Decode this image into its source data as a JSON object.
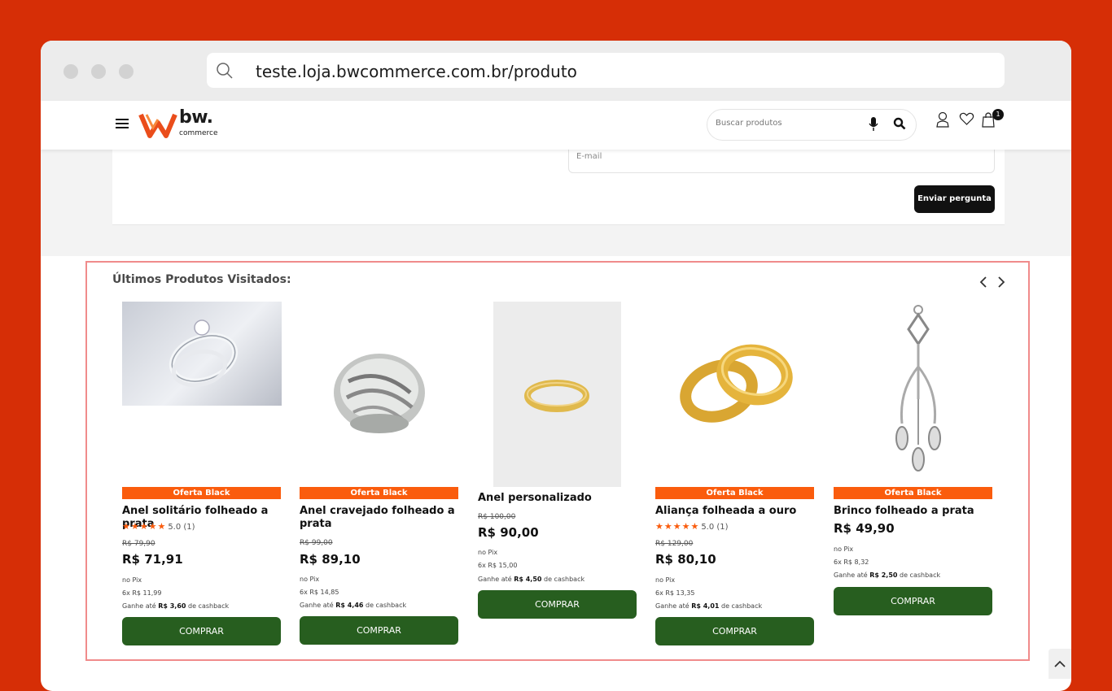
{
  "browser": {
    "url": "teste.loja.bwcommerce.com.br/produto"
  },
  "header": {
    "logo_text": "bw.",
    "logo_sub": "commerce",
    "search_placeholder": "Buscar produtos",
    "cart_count": "1"
  },
  "form": {
    "email_placeholder": "E-mail",
    "send_label": "Enviar pergunta"
  },
  "recent": {
    "title": "Últimos Produtos Visitados:",
    "products": [
      {
        "tag": "Oferta Black",
        "name": "Anel solitário folheado a prata",
        "stars": "★★★★★",
        "rating": "5.0 (1)",
        "old_price": "R$ 79,90",
        "price": "R$ 71,91",
        "pix": "no  Pix",
        "installments": "6x  R$ 11,99",
        "cashback_pre": "Ganhe até ",
        "cashback_value": "R$ 3,60",
        "cashback_post": " de cashback",
        "buy": "COMPRAR"
      },
      {
        "tag": "Oferta Black",
        "name": "Anel cravejado folheado a prata",
        "old_price": "R$ 99,00",
        "price": "R$ 89,10",
        "pix": "no  Pix",
        "installments": "6x  R$ 14,85",
        "cashback_pre": "Ganhe até ",
        "cashback_value": "R$ 4,46",
        "cashback_post": " de cashback",
        "buy": "COMPRAR"
      },
      {
        "name": "Anel personalizado",
        "old_price": "R$ 100,00",
        "price": "R$ 90,00",
        "pix": "no  Pix",
        "installments": "6x  R$ 15,00",
        "cashback_pre": "Ganhe até ",
        "cashback_value": "R$ 4,50",
        "cashback_post": " de cashback",
        "buy": "COMPRAR"
      },
      {
        "tag": "Oferta Black",
        "name": "Aliança folheada a ouro",
        "stars": "★★★★★",
        "rating": "5.0 (1)",
        "old_price": "R$ 129,00",
        "price": "R$ 80,10",
        "pix": "no  Pix",
        "installments": "6x  R$ 13,35",
        "cashback_pre": "Ganhe até ",
        "cashback_value": "R$ 4,01",
        "cashback_post": " de cashback",
        "buy": "COMPRAR"
      },
      {
        "tag": "Oferta Black",
        "name": "Brinco folheado a prata",
        "price": "R$ 49,90",
        "pix": "no  Pix",
        "installments": "6x  R$ 8,32",
        "cashback_pre": "Ganhe até ",
        "cashback_value": "R$ 2,50",
        "cashback_post": " de cashback",
        "buy": "COMPRAR"
      }
    ]
  },
  "colors": {
    "background": "#d62e06",
    "accent": "#fa5c0d",
    "buy_button": "#275e1f"
  },
  "icons": [
    "search-icon",
    "menu-icon",
    "mic-icon",
    "user-icon",
    "heart-icon",
    "bag-icon",
    "chevron-left-icon",
    "chevron-right-icon",
    "chevron-up-icon"
  ]
}
